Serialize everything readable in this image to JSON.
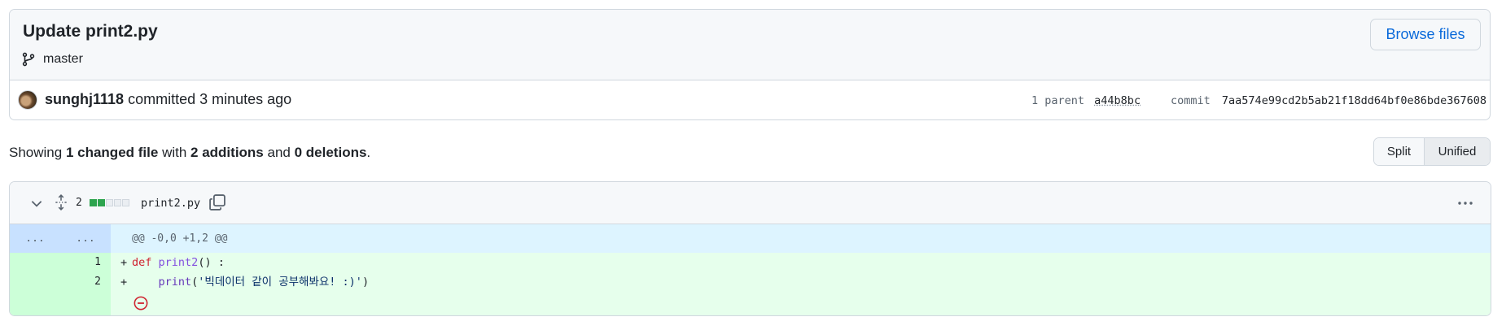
{
  "commit": {
    "title": "Update print2.py",
    "branch": "master",
    "browse_label": "Browse files",
    "author": "sunghj1118",
    "action": "committed",
    "time": "3 minutes ago",
    "parent_label": "1 parent",
    "parent_hash": "a44b8bc",
    "commit_label": "commit",
    "commit_hash": "7aa574e99cd2b5ab21f18dd64bf0e86bde367608"
  },
  "summary": {
    "showing": "Showing",
    "changed": "1 changed file",
    "with": "with",
    "additions": "2 additions",
    "and": "and",
    "deletions": "0 deletions",
    "period": "."
  },
  "view_toggle": {
    "split": "Split",
    "unified": "Unified",
    "selected": "Unified"
  },
  "file": {
    "change_count": "2",
    "diffstat": [
      "add",
      "add",
      "neutral",
      "neutral",
      "neutral"
    ],
    "name": "print2.py",
    "hunk_left": "...",
    "hunk_right": "...",
    "hunk_header": "@@ -0,0 +1,2 @@",
    "lines": [
      {
        "num": "1",
        "marker": "+",
        "kw": "def",
        "fn": "print2",
        "rest": "() :"
      },
      {
        "num": "2",
        "marker": "+",
        "indent": "    ",
        "bi": "print",
        "open": "(",
        "str": "'빅데이터 같이 공부해봐요! :)'",
        "close": ")"
      }
    ]
  },
  "icons": {
    "branch": "git-branch-icon",
    "chevron": "chevron-down-icon",
    "expand": "unfold-icon",
    "copy": "copy-icon",
    "more": "kebab-horizontal-icon",
    "no_newline": "no-entry-icon"
  },
  "colors": {
    "link": "#0969da",
    "addition_bg": "#e6ffec",
    "addition_gutter": "#ccffd8",
    "hunk_bg": "#ddf4ff",
    "no_newline": "#cf222e"
  }
}
